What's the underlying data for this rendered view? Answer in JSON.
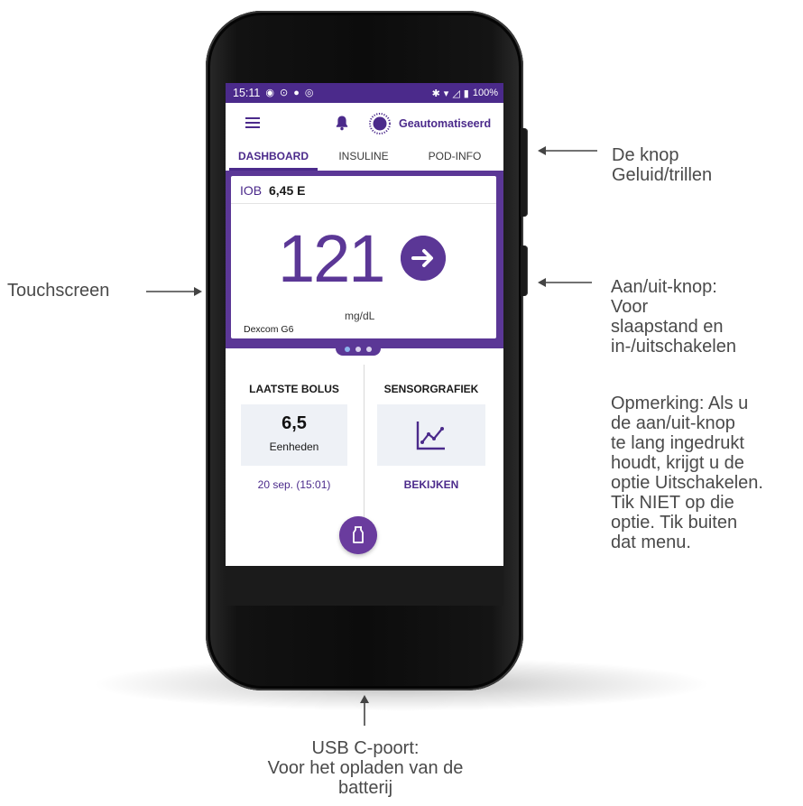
{
  "status_bar": {
    "time": "15:11",
    "battery": "100%"
  },
  "app_bar": {
    "mode_label": "Geautomatiseerd"
  },
  "tabs": [
    {
      "label": "DASHBOARD",
      "active": true
    },
    {
      "label": "INSULINE",
      "active": false
    },
    {
      "label": "POD-INFO",
      "active": false
    }
  ],
  "sensor_card": {
    "iob_label": "IOB",
    "iob_value": "6,45 E",
    "glucose_value": "121",
    "unit": "mg/dL",
    "sensor_name": "Dexcom G6",
    "page_dots": 3,
    "active_dot": 0
  },
  "last_bolus": {
    "title": "LAATSTE BOLUS",
    "value": "6,5",
    "unit": "Eenheden",
    "date": "20 sep. (15:01)"
  },
  "sensor_graph": {
    "title": "SENSORGRAFIEK",
    "link": "BEKIJKEN"
  },
  "callouts": {
    "sound_button": [
      "De knop",
      "Geluid/trillen"
    ],
    "touchscreen": "Touchscreen",
    "power_button": [
      "Aan/uit-knop:",
      "Voor",
      "slaapstand en",
      "in-/uitschakelen"
    ],
    "note": [
      "Opmerking: Als u",
      "de aan/uit-knop",
      "te lang ingedrukt",
      "houdt, krijgt u de",
      "optie Uitschakelen.",
      "Tik NIET op die",
      "optie. Tik buiten",
      "dat menu."
    ],
    "usb": [
      "USB C-poort:",
      "Voor het opladen van de",
      "batterij"
    ]
  },
  "colors": {
    "brand_purple": "#5b3796",
    "status_bar": "#4b2a8b",
    "callout_text": "#4a4a4a"
  },
  "icons": [
    "menu-icon",
    "bell-icon",
    "automated-mode-icon",
    "arrow-right-icon",
    "line-chart-icon",
    "bolus-pod-icon",
    "bluetooth-icon",
    "wifi-icon",
    "signal-icon",
    "battery-icon"
  ]
}
